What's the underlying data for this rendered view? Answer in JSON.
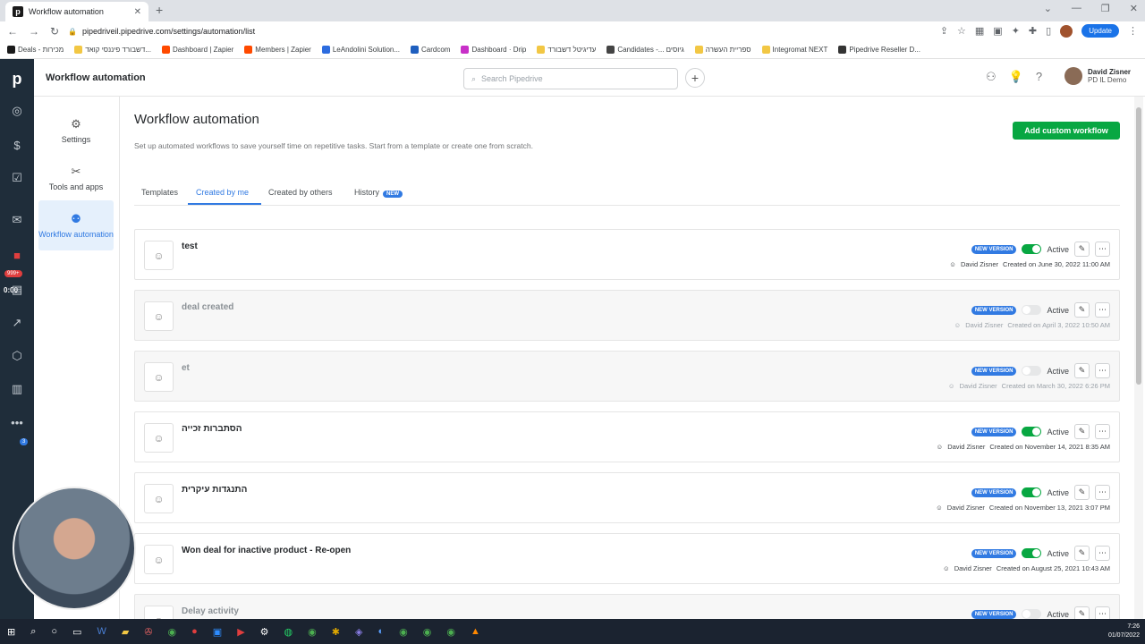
{
  "browser": {
    "tab_title": "Workflow automation",
    "url": "pipedriveil.pipedrive.com/settings/automation/list",
    "update_label": "Update",
    "bookmarks": [
      {
        "label": "Deals - מכירות",
        "color": "#1a1a1a"
      },
      {
        "label": "דשבורד פיננסי קואד...",
        "color": "#f2c744"
      },
      {
        "label": "Dashboard | Zapier",
        "color": "#ff4a00"
      },
      {
        "label": "Members | Zapier",
        "color": "#ff4a00"
      },
      {
        "label": "LeAndolini Solution...",
        "color": "#2d6cdf"
      },
      {
        "label": "Cardcom",
        "color": "#1f5fbf"
      },
      {
        "label": "Dashboard · Drip",
        "color": "#c830c8"
      },
      {
        "label": "עדיגיטל דשבורד",
        "color": "#f2c744"
      },
      {
        "label": "Candidates -... גיוסים",
        "color": "#444444"
      },
      {
        "label": "ספריית העשרה",
        "color": "#f2c744"
      },
      {
        "label": "Integromat NEXT",
        "color": "#f2c744"
      },
      {
        "label": "Pipedrive Reseller D...",
        "color": "#333333"
      }
    ]
  },
  "app": {
    "title": "Workflow automation",
    "search_placeholder": "Search Pipedrive",
    "user_name": "David Zisner",
    "company": "PD IL Demo",
    "badge_count": "999+",
    "timer": "0:00",
    "badge_small": "3"
  },
  "subnav": [
    {
      "label": "Settings",
      "icon": "gear-icon"
    },
    {
      "label": "Tools and apps",
      "icon": "tools-icon"
    },
    {
      "label": "Workflow automation",
      "icon": "automation-icon",
      "active": true
    }
  ],
  "page": {
    "title": "Workflow automation",
    "subtitle": "Set up automated workflows to save yourself time on repetitive tasks. Start from a template or create one from scratch.",
    "add_button": "Add custom workflow",
    "tabs": [
      {
        "label": "Templates"
      },
      {
        "label": "Created by me",
        "active": true
      },
      {
        "label": "Created by others"
      },
      {
        "label": "History",
        "pill": "NEW"
      }
    ]
  },
  "workflows": [
    {
      "name": "test",
      "badge": "NEW VERSION",
      "active": true,
      "status": "Active",
      "owner": "David Zisner",
      "created": "Created on June 30, 2022 11:00 AM"
    },
    {
      "name": "deal created",
      "badge": "NEW VERSION",
      "active": false,
      "status": "Active",
      "owner": "David Zisner",
      "created": "Created on April 3, 2022 10:50 AM"
    },
    {
      "name": "et",
      "badge": "NEW VERSION",
      "active": false,
      "status": "Active",
      "owner": "David Zisner",
      "created": "Created on March 30, 2022 6:26 PM"
    },
    {
      "name": "הסתברות זכייה",
      "badge": "NEW VERSION",
      "active": true,
      "status": "Active",
      "owner": "David Zisner",
      "created": "Created on November 14, 2021 8:35 AM"
    },
    {
      "name": "התנגדות עיקרית",
      "badge": "NEW VERSION",
      "active": true,
      "status": "Active",
      "owner": "David Zisner",
      "created": "Created on November 13, 2021 3:07 PM"
    },
    {
      "name": "Won deal for inactive product - Re-open",
      "badge": "NEW VERSION",
      "active": true,
      "status": "Active",
      "owner": "David Zisner",
      "created": "Created on August 25, 2021 10:43 AM"
    },
    {
      "name": "Delay activity",
      "badge": "NEW VERSION",
      "active": false,
      "status": "Active",
      "owner": "",
      "created": ""
    }
  ],
  "taskbar": {
    "time": "7:26",
    "date": "01/07/2022"
  }
}
